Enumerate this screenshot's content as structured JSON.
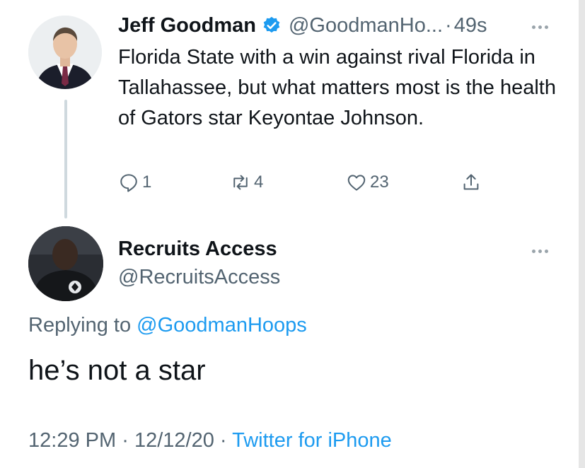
{
  "parent_tweet": {
    "display_name": "Jeff Goodman",
    "handle": "@GoodmanHo...",
    "separator": "·",
    "time": "49s",
    "text": "Florida State with a win against rival Florida in Tallahassee, but what matters most is the health of Gators star Keyontae Johnson.",
    "actions": {
      "reply_count": "1",
      "retweet_count": "4",
      "like_count": "23"
    }
  },
  "reply_tweet": {
    "display_name": "Recruits Access",
    "handle": "@RecruitsAccess",
    "replying_prefix": "Replying to",
    "replying_mention": "@GoodmanHoops",
    "text": "he’s not a star",
    "time": "12:29 PM",
    "separator1": "·",
    "date": "12/12/20",
    "separator2": "·",
    "source": "Twitter for iPhone"
  },
  "colors": {
    "accent": "#1d9bf0",
    "muted": "#536471",
    "text": "#0f1419",
    "thread_line": "#cfd9de"
  },
  "icons": {
    "verified": "verified-badge-icon",
    "reply": "reply-icon",
    "retweet": "retweet-icon",
    "like": "heart-icon",
    "share": "share-icon",
    "more": "more-icon"
  }
}
